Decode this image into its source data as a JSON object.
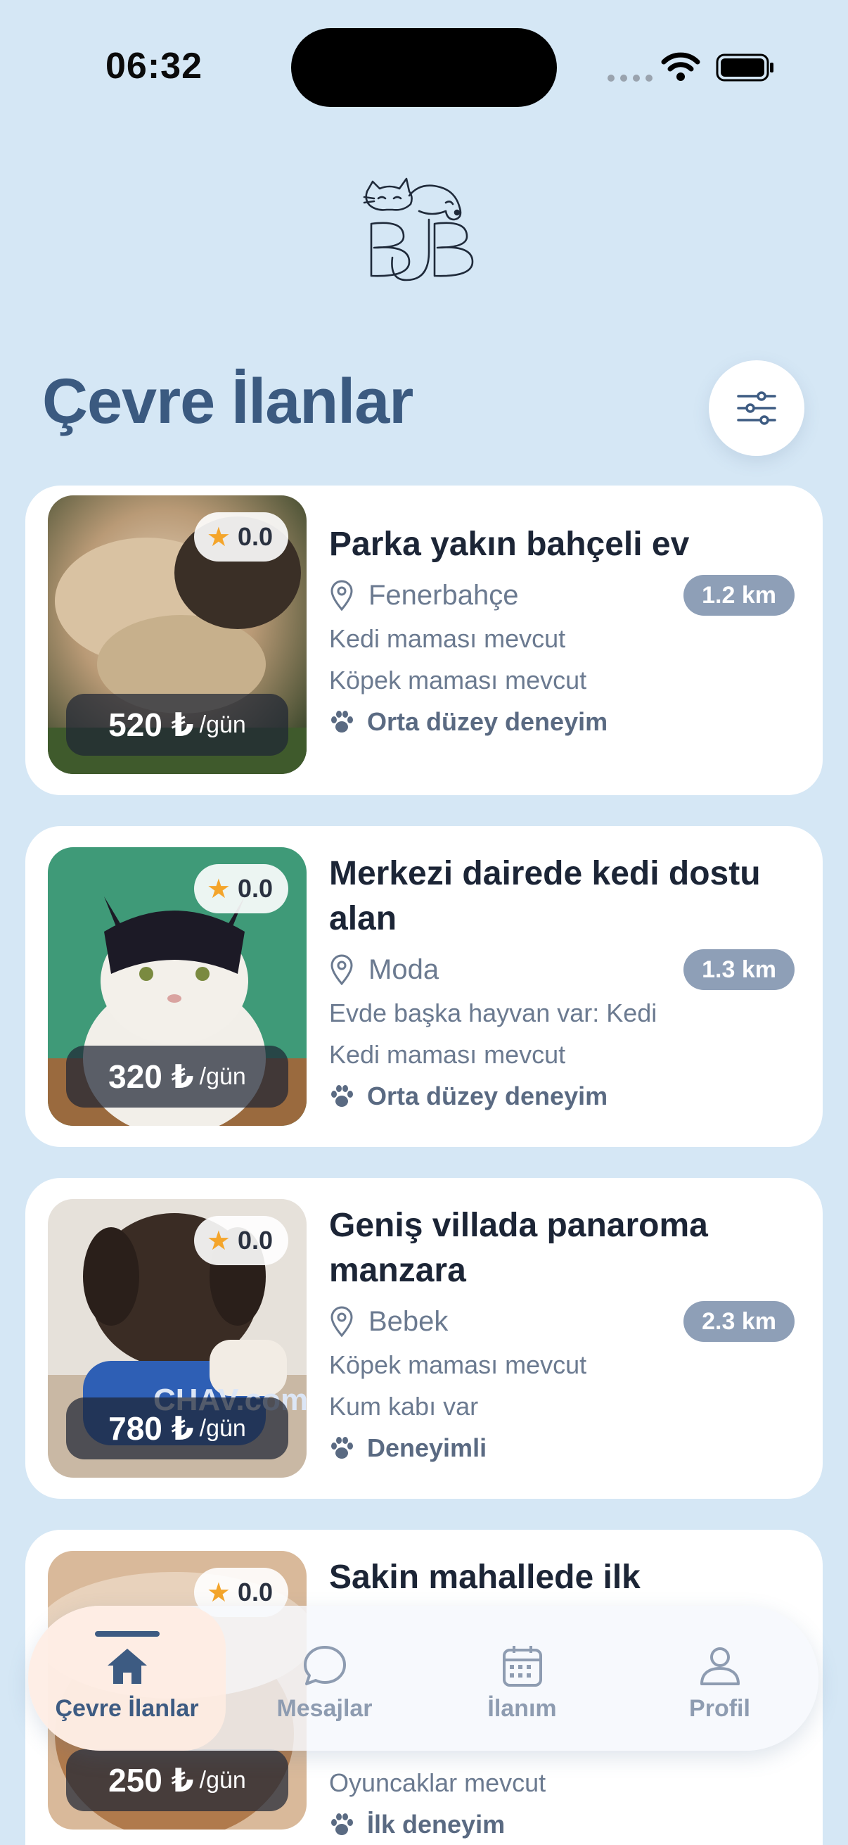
{
  "status": {
    "time": "06:32"
  },
  "header": {
    "title": "Çevre İlanlar"
  },
  "listings": [
    {
      "rating": "0.0",
      "price": "520 ₺",
      "unit": "/gün",
      "title": "Parka yakın bahçeli ev",
      "location": "Fenerbahçe",
      "distance": "1.2 km",
      "features": [
        "Kedi maması mevcut",
        "Köpek maması mevcut"
      ],
      "experience": "Orta düzey deneyim",
      "photo": "cat-and-dog"
    },
    {
      "rating": "0.0",
      "price": "320 ₺",
      "unit": "/gün",
      "title": "Merkezi dairede kedi dostu alan",
      "location": "Moda",
      "distance": "1.3 km",
      "features": [
        "Evde başka hayvan var: Kedi",
        "Kedi maması mevcut"
      ],
      "experience": "Orta düzey deneyim",
      "photo": "cat"
    },
    {
      "rating": "0.0",
      "price": "780 ₺",
      "unit": "/gün",
      "title": "Geniş villada panaroma manzara",
      "location": "Bebek",
      "distance": "2.3 km",
      "features": [
        "Köpek maması mevcut",
        "Kum kabı var"
      ],
      "experience": "Deneyimli",
      "photo": "dog"
    },
    {
      "rating": "0.0",
      "price": "250 ₺",
      "unit": "/gün",
      "title": "Sakin mahallede ilk",
      "features": [
        "Oyuncaklar mevcut"
      ],
      "experience": "İlk deneyim",
      "photo": "dog-outdoor"
    }
  ],
  "tabbar": {
    "tabs": [
      {
        "label": "Çevre İlanlar",
        "icon": "home-icon",
        "active": true
      },
      {
        "label": "Mesajlar",
        "icon": "chat-icon"
      },
      {
        "label": "İlanım",
        "icon": "calendar-icon"
      },
      {
        "label": "Profil",
        "icon": "profile-icon"
      }
    ]
  },
  "colors": {
    "background": "#d5e7f5",
    "title": "#3b5a80",
    "accent": "#8e9fb7",
    "star": "#f4a52b"
  }
}
